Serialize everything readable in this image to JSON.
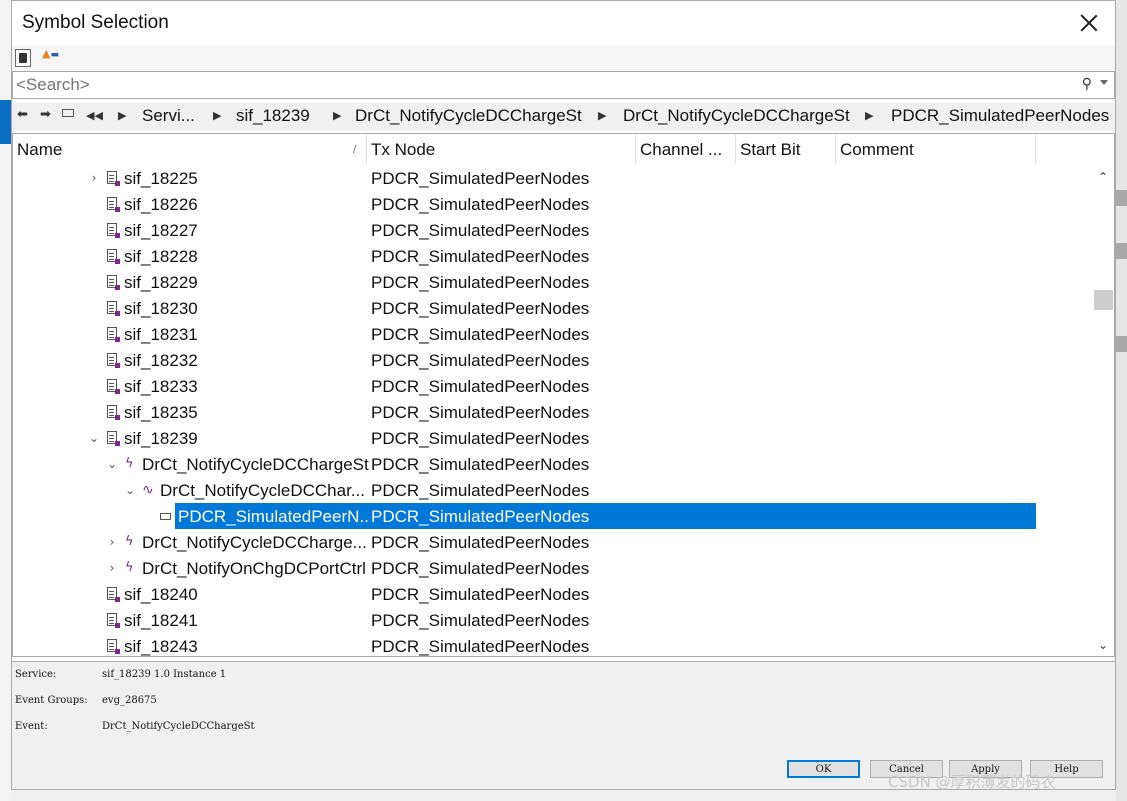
{
  "window": {
    "title": "Symbol Selection"
  },
  "search": {
    "placeholder": "<Search>"
  },
  "breadcrumb": [
    "Servi...",
    "sif_18239",
    "DrCt_NotifyCycleDCChargeSt",
    "DrCt_NotifyCycleDCChargeSt",
    "PDCR_SimulatedPeerNodes"
  ],
  "columns": [
    "Name",
    "Tx Node",
    "Channel ...",
    "Start Bit",
    "Comment"
  ],
  "rows": [
    {
      "name": "sif_18225",
      "tx": "PDCR_SimulatedPeerNodes"
    },
    {
      "name": "sif_18226",
      "tx": "PDCR_SimulatedPeerNodes"
    },
    {
      "name": "sif_18227",
      "tx": "PDCR_SimulatedPeerNodes"
    },
    {
      "name": "sif_18228",
      "tx": "PDCR_SimulatedPeerNodes"
    },
    {
      "name": "sif_18229",
      "tx": "PDCR_SimulatedPeerNodes"
    },
    {
      "name": "sif_18230",
      "tx": "PDCR_SimulatedPeerNodes"
    },
    {
      "name": "sif_18231",
      "tx": "PDCR_SimulatedPeerNodes"
    },
    {
      "name": "sif_18232",
      "tx": "PDCR_SimulatedPeerNodes"
    },
    {
      "name": "sif_18233",
      "tx": "PDCR_SimulatedPeerNodes"
    },
    {
      "name": "sif_18235",
      "tx": "PDCR_SimulatedPeerNodes"
    },
    {
      "name": "sif_18239",
      "tx": "PDCR_SimulatedPeerNodes"
    },
    {
      "name": "DrCt_NotifyCycleDCChargeSt",
      "tx": "PDCR_SimulatedPeerNodes"
    },
    {
      "name": "DrCt_NotifyCycleDCChar...",
      "tx": "PDCR_SimulatedPeerNodes"
    },
    {
      "name": "PDCR_SimulatedPeerN...",
      "tx": "PDCR_SimulatedPeerNodes"
    },
    {
      "name": "DrCt_NotifyCycleDCCharge...",
      "tx": "PDCR_SimulatedPeerNodes"
    },
    {
      "name": "DrCt_NotifyOnChgDCPortCtrl",
      "tx": "PDCR_SimulatedPeerNodes"
    },
    {
      "name": "sif_18240",
      "tx": "PDCR_SimulatedPeerNodes"
    },
    {
      "name": "sif_18241",
      "tx": "PDCR_SimulatedPeerNodes"
    },
    {
      "name": "sif_18243",
      "tx": "PDCR_SimulatedPeerNodes"
    }
  ],
  "info": {
    "service_label": "Service:",
    "service_value": "sif_18239 1.0 Instance 1",
    "event_groups_label": "Event Groups:",
    "event_groups_value": "evg_28675",
    "event_label": "Event:",
    "event_value": "DrCt_NotifyCycleDCChargeSt"
  },
  "buttons": {
    "ok": "OK",
    "cancel": "Cancel",
    "apply": "Apply",
    "help": "Help"
  },
  "watermark": "CSDN @厚积薄发的码农",
  "colors": {
    "selection": "#0078d7",
    "signal_icon": "#7a2c8e"
  }
}
